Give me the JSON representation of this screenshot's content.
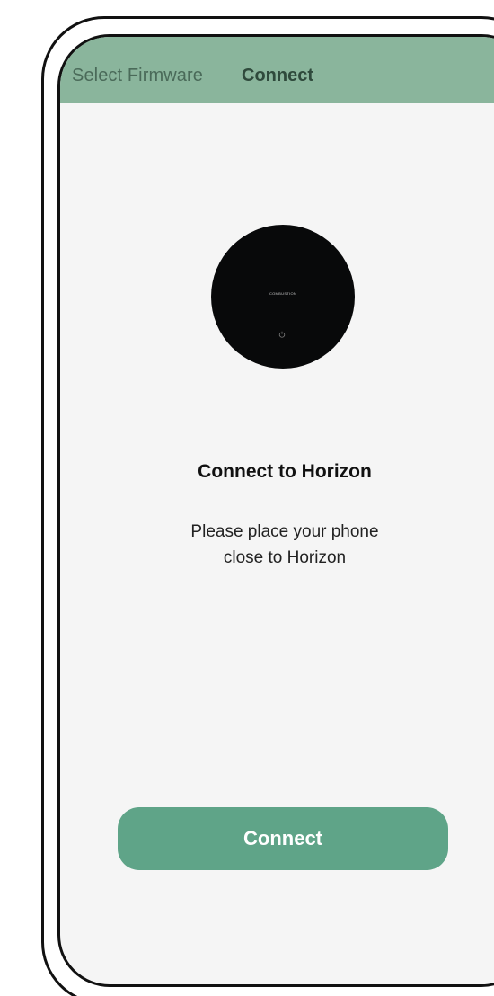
{
  "nav": {
    "back_label": "Select Firmware",
    "title": "Connect"
  },
  "device": {
    "brand_text": "COMBUSTION",
    "icon": "power-icon"
  },
  "content": {
    "heading": "Connect to Horizon",
    "instruction_line1": "Please place your phone",
    "instruction_line2": "close to Horizon"
  },
  "actions": {
    "connect_label": "Connect"
  },
  "colors": {
    "nav_background": "#8ab59c",
    "button_background": "#5fa488",
    "screen_background": "#f5f5f5"
  }
}
